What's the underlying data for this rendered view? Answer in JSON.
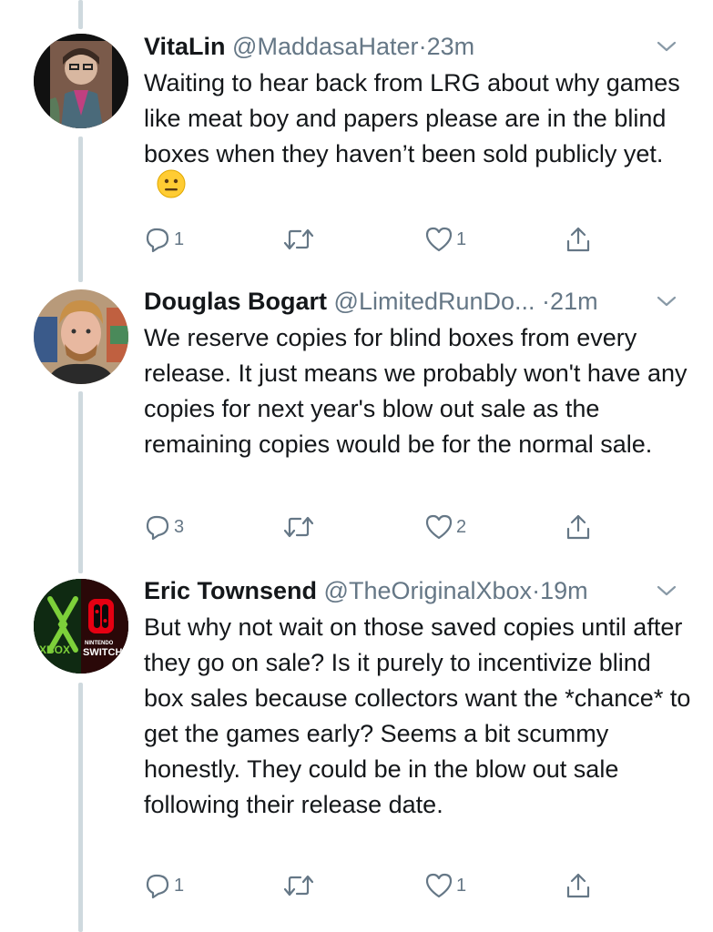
{
  "tweets": [
    {
      "name": "VitaLin",
      "handle": "@MaddasaHater",
      "time": "23m",
      "text": "Waiting to hear back from LRG about why games like meat boy and papers please are in the blind boxes when they haven’t been sold publicly yet.",
      "emoji": "neutral-face-emoji",
      "replies": "1",
      "retweets": "",
      "likes": "1"
    },
    {
      "name": "Douglas Bogart",
      "handle": "@LimitedRunDo...",
      "time": "21m",
      "text": "We reserve copies for blind boxes from every release. It just means we probably won't have any copies for next year's blow out sale as the remaining copies would be for the normal sale.",
      "replies": "3",
      "retweets": "",
      "likes": "2"
    },
    {
      "name": "Eric Townsend",
      "handle": "@TheOriginalXbox",
      "time": "19m",
      "text": "But why not wait on those saved copies until after they go on sale? Is it purely to incentivize blind box sales because collectors want the *chance* to get the games early? Seems a bit scummy honestly. They could be in the blow out sale following their release date.",
      "avatar_text": [
        "XBOX",
        "NINTENDO",
        "SWITCH"
      ],
      "replies": "1",
      "retweets": "",
      "likes": "1"
    }
  ],
  "separator": "·",
  "icons": {
    "reply": "reply-icon",
    "retweet": "retweet-icon",
    "like": "heart-icon",
    "share": "share-icon",
    "more": "chevron-down-icon"
  },
  "colors": {
    "text": "#14171a",
    "secondary": "#657786",
    "thread_line": "#cfd9de"
  }
}
